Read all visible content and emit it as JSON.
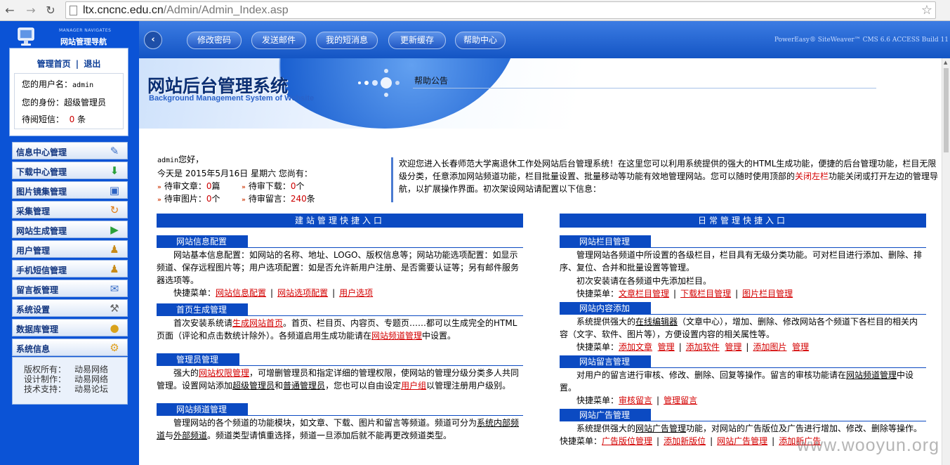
{
  "browser": {
    "url_host": "ltx.cncnc.edu.cn",
    "url_path": "/Admin/Admin_Index.asp"
  },
  "sidebar": {
    "tag_en": "MANAGER NAVIGATES",
    "tag_cn": "网站管理导航",
    "home_link": "管理首页",
    "divider": "|",
    "logout_link": "退出",
    "user_label": "您的用户名：",
    "user_value": "admin",
    "role_label": "您的身份：",
    "role_value": "超级管理员",
    "msg_label": "待阅短信：",
    "msg_count": "0",
    "msg_unit": "条",
    "menu": [
      {
        "label": "信息中心管理",
        "icon": "edit-icon"
      },
      {
        "label": "下载中心管理",
        "icon": "download-icon"
      },
      {
        "label": "图片镜集管理",
        "icon": "image-icon"
      },
      {
        "label": "采集管理",
        "icon": "refresh-icon"
      },
      {
        "label": "网站生成管理",
        "icon": "play-icon"
      },
      {
        "label": "用户管理",
        "icon": "user-icon"
      },
      {
        "label": "手机短信管理",
        "icon": "user-icon"
      },
      {
        "label": "留言板管理",
        "icon": "message-icon"
      },
      {
        "label": "系统设置",
        "icon": "tools-icon"
      },
      {
        "label": "数据库管理",
        "icon": "lock-icon"
      },
      {
        "label": "系统信息",
        "icon": "gear-icon"
      }
    ],
    "footer": [
      {
        "k": "版权所有：",
        "v": "动易网络"
      },
      {
        "k": "设计制作：",
        "v": "动易网络"
      },
      {
        "k": "技术支持：",
        "v": "动易论坛"
      }
    ]
  },
  "topbar": {
    "buttons": [
      "修改密码",
      "发送邮件",
      "我的短消息",
      "更新缓存",
      "帮助中心"
    ],
    "version": "PowerEasy® SiteWeaver™ CMS 6.6 ACCESS Build 11"
  },
  "banner": {
    "title": "网站后台管理系统",
    "subtitle": "Background Management System of Website",
    "notice_label": "帮助公告"
  },
  "welcome": {
    "greeting_user": "admin",
    "greeting_suffix": "您好，",
    "date_line": "今天是 2015年5月16日 星期六 您尚有：",
    "stats": [
      {
        "label": "待审文章：",
        "value": "0",
        "unit": "篇"
      },
      {
        "label": "待审下载：",
        "value": "0",
        "unit": "个"
      },
      {
        "label": "待审图片：",
        "value": "0",
        "unit": "个"
      },
      {
        "label": "待审留言：",
        "value": "240",
        "unit": "条"
      }
    ],
    "intro_1": "欢迎您进入长春师范大学离退休工作处网站后台管理系统！在这里您可以利用系统提供的强大的HTML生成功能，便捷的后台管理功能，栏目无限级分类，任意添加网站频道功能，栏目批量设置、批量移动等功能有效地管理网站。您可以随时使用顶部的",
    "intro_link": "关闭左栏",
    "intro_2": "功能关闭或打开左边的管理导航，以扩展操作界面。初次架设网站请配置以下信息："
  },
  "left_col": {
    "title": "建站管理快捷入口",
    "b1": {
      "tab": "网站信息配置",
      "text": "网站基本信息配置：如网站的名称、地址、LOGO、版权信息等；网站功能选项配置：如显示频道、保存远程图片等；用户选项配置：如是否允许新用户注册、是否需要认证等；另有邮件服务器选项等。",
      "quick_label": "快捷菜单：",
      "links": [
        "网站信息配置",
        "网站选项配置",
        "用户选项"
      ]
    },
    "b2": {
      "tab": "首页生成管理",
      "t1": "首次安装系统请",
      "l1": "生成网站首页",
      "t2": "。首页、栏目页、内容页、专题页……都可以生成完全的HTML页面（评论和点击数统计除外）。各频道启用生成功能请在",
      "l2": "网站频道管理",
      "t3": "中设置。"
    },
    "b3": {
      "tab": "管理员管理",
      "t1": "强大的",
      "l1": "网站权限管理",
      "t2": "，可增删管理员和指定详细的管理权限，使网站的管理分级分类多人共同管理。设置网站添加",
      "u1": "超级管理员",
      "t3": "和",
      "u2": "普通管理员",
      "t4": "，您也可以自由设定",
      "l2": "用户组",
      "t5": "以管理注册用户级别。"
    },
    "b4": {
      "tab": "网站频道管理",
      "t1": "管理网站的各个频道的功能模块，如文章、下载、图片和留言等频道。频道可分为",
      "u1": "系统内部频道",
      "t2": "与",
      "u2": "外部频道",
      "t3": "。频道类型请慎重选择，频道一旦添加后就不能再更改频道类型。"
    }
  },
  "right_col": {
    "title": "日常管理快捷入口",
    "b1": {
      "tab": "网站栏目管理",
      "text": "管理网站各频道中所设置的各级栏目，栏目具有无级分类功能。可对栏目进行添加、删除、排序、复位、合并和批量设置等管理。",
      "note": "初次安装请在各频道中先添加栏目。",
      "quick_label": "快捷菜单：",
      "links": [
        "文章栏目管理",
        "下载栏目管理",
        "图片栏目管理"
      ]
    },
    "b2": {
      "tab": "网站内容添加",
      "t1": "系统提供强大的",
      "u1": "在线编辑器",
      "t2": "（文章中心），增加、删除、修改网站各个频道下各栏目的相关内容（文字、软件、图片等），方便设置内容的相关属性等。",
      "quick_label": "快捷菜单：",
      "links": [
        "添加文章",
        "管理",
        "添加软件",
        "管理",
        "添加图片",
        "管理"
      ]
    },
    "b3": {
      "tab": "网站留言管理",
      "t1": "对用户的留言进行审核、修改、删除、回复等操作。留言的审核功能请在",
      "u1": "网站频道管理",
      "t2": "中设置。",
      "quick_label": "快捷菜单：",
      "links": [
        "审核留言",
        "管理留言"
      ]
    },
    "b4": {
      "tab": "网站广告管理",
      "t1": "系统提供强大的",
      "u1": "网站广告管理",
      "t2": "功能，对网站的广告版位及广告进行增加、修改、删除等操作。",
      "quick_label": "快捷菜单：",
      "links": [
        "广告版位管理",
        "添加新版位",
        "网站广告管理",
        "添加新广告"
      ]
    }
  },
  "watermark": "www.wooyun.org",
  "colors": {
    "nav_blue": "#0b53d6",
    "section_blue": "#0b4ac2",
    "link_red": "#d40000"
  }
}
